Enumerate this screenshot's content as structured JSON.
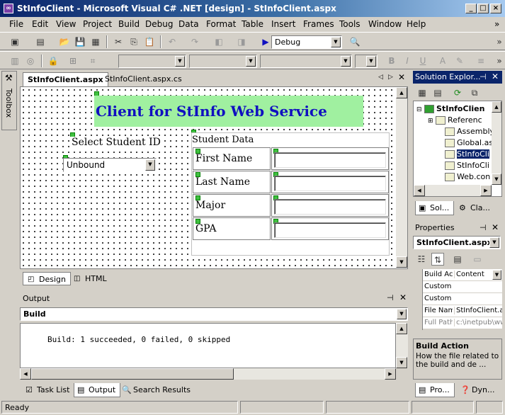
{
  "window": {
    "title": "StInfoClient - Microsoft Visual C# .NET [design] - StInfoClient.aspx",
    "min": "_",
    "max": "□",
    "close": "×"
  },
  "menu": [
    "File",
    "Edit",
    "View",
    "Project",
    "Build",
    "Debug",
    "Data",
    "Format",
    "Table",
    "Insert",
    "Frames",
    "Tools",
    "Window",
    "Help"
  ],
  "toolbar": {
    "config": "Debug"
  },
  "toolbox_label": "Toolbox",
  "doc_tabs": [
    "StInfoClient.aspx",
    "StInfoClient.aspx.cs"
  ],
  "designer": {
    "heading": "Client for StInfo Web Service",
    "select_label": "Select Student ID",
    "dropdown_value": "Unbound",
    "table_caption": "Student Data",
    "fields": [
      "First Name",
      "Last Name",
      "Major",
      "GPA"
    ]
  },
  "view_tabs": [
    "Design",
    "HTML"
  ],
  "output": {
    "title": "Output",
    "pane": "Build",
    "text": "Build: 1 succeeded, 0 failed, 0 skipped"
  },
  "bottom_tabs": [
    "Task List",
    "Output",
    "Search Results"
  ],
  "solution_explorer": {
    "title": "Solution Explor...",
    "items": [
      "StInfoClien",
      "Referenc",
      "Assembly",
      "Global.as",
      "StInfoCli",
      "StInfoCli",
      "Web.con"
    ],
    "tabs": [
      "Sol...",
      "Cla..."
    ]
  },
  "properties": {
    "title": "Properties",
    "object": "StInfoClient.aspx",
    "rows": [
      {
        "name": "Build Act",
        "value": "Content"
      },
      {
        "name": "Custom",
        "value": ""
      },
      {
        "name": "Custom",
        "value": ""
      },
      {
        "name": "File Nam",
        "value": "StInfoClient.a"
      },
      {
        "name": "Full Path",
        "value": "c:\\inetpub\\ww"
      }
    ],
    "desc_title": "Build Action",
    "desc_text": "How the file related to the build and de ...",
    "tabs": [
      "Pro...",
      "Dyn..."
    ]
  },
  "status": {
    "text": "Ready"
  }
}
